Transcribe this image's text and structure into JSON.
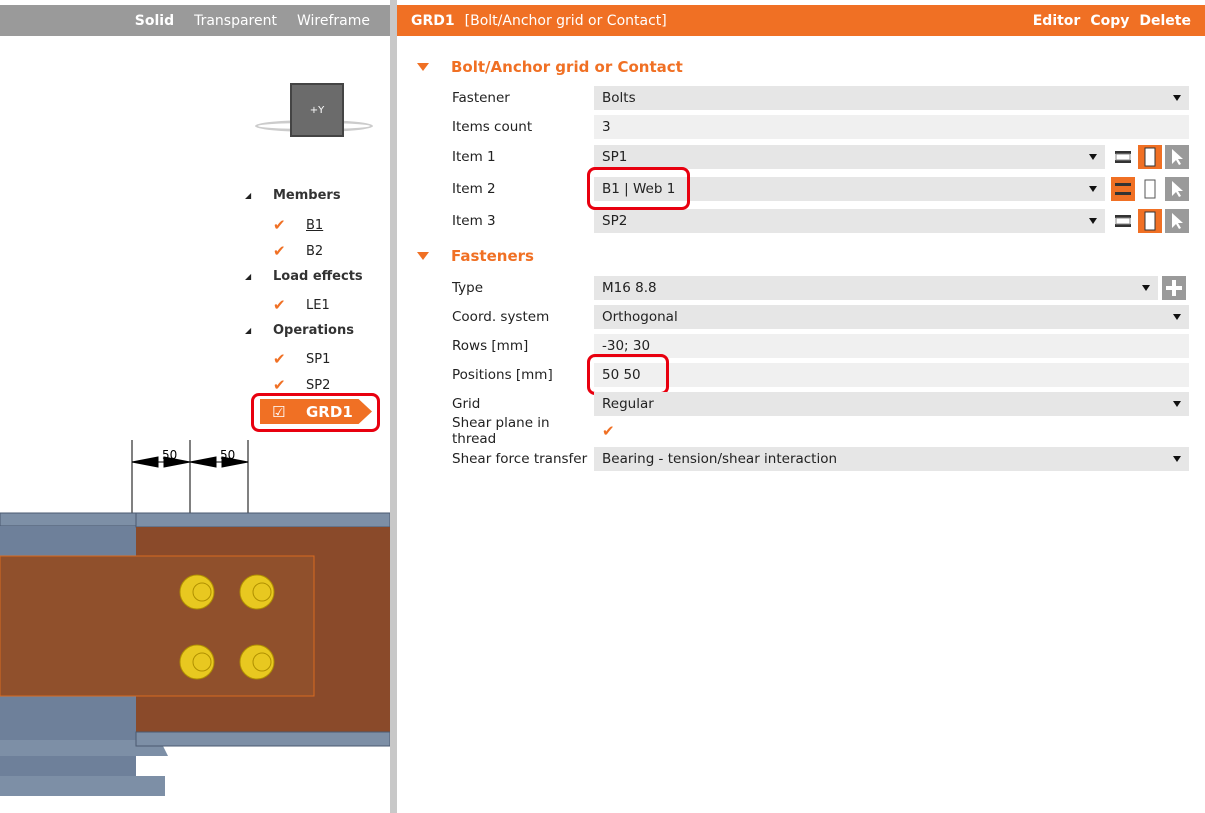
{
  "view_modes": {
    "solid": "Solid",
    "transparent": "Transparent",
    "wireframe": "Wireframe"
  },
  "view_cube": {
    "label": "+Y"
  },
  "tree": {
    "members": {
      "label": "Members",
      "items": [
        "B1",
        "B2"
      ]
    },
    "load_effects": {
      "label": "Load effects",
      "items": [
        "LE1"
      ]
    },
    "operations": {
      "label": "Operations",
      "items": [
        "SP1",
        "SP2",
        "GRD1"
      ]
    }
  },
  "model": {
    "dims": [
      "50",
      "50"
    ]
  },
  "header": {
    "id": "GRD1",
    "type": "[Bolt/Anchor grid or Contact]",
    "editor": "Editor",
    "copy": "Copy",
    "delete": "Delete"
  },
  "section1": {
    "title": "Bolt/Anchor grid or Contact",
    "fastener": {
      "label": "Fastener",
      "value": "Bolts"
    },
    "items_count": {
      "label": "Items count",
      "value": "3"
    },
    "item1": {
      "label": "Item 1",
      "value": "SP1"
    },
    "item2": {
      "label": "Item 2",
      "value": "B1 | Web 1"
    },
    "item3": {
      "label": "Item 3",
      "value": "SP2"
    }
  },
  "section2": {
    "title": "Fasteners",
    "type": {
      "label": "Type",
      "value": "M16 8.8"
    },
    "coord": {
      "label": "Coord. system",
      "value": "Orthogonal"
    },
    "rows": {
      "label": "Rows [mm]",
      "value": "-30; 30"
    },
    "positions": {
      "label": "Positions [mm]",
      "value": "50 50"
    },
    "grid": {
      "label": "Grid",
      "value": "Regular"
    },
    "shear_plane": {
      "label": "Shear plane in thread",
      "checked": true
    },
    "shear_force": {
      "label": "Shear force transfer",
      "value": "Bearing - tension/shear interaction"
    }
  },
  "colors": {
    "accent": "#f07024",
    "highlight": "#e8000f"
  }
}
